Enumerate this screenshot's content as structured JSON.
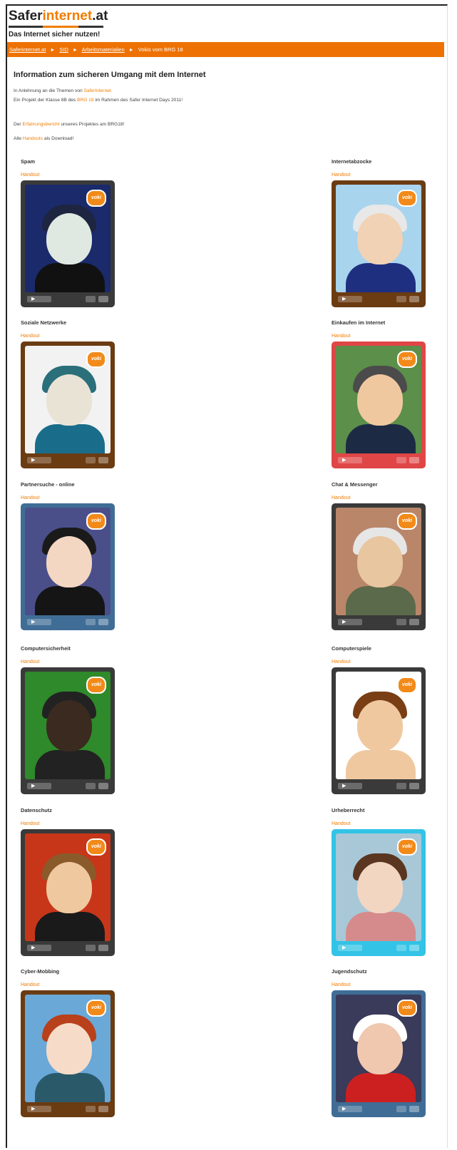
{
  "site": {
    "logo_safer": "Safer",
    "logo_internet": "internet",
    "logo_at": ".at",
    "tagline": "Das Internet sicher nutzen!"
  },
  "breadcrumb": {
    "items": [
      "Saferinternet.at",
      "SID",
      "Arbeitsmaterialien"
    ],
    "current": "Vokis vom BRG 18",
    "separator": "►"
  },
  "intro": {
    "heading": "Information zum sicheren Umgang mit dem Internet",
    "line1_prefix": "In Anlehnung an die Themen von ",
    "line1_link": "SaferInternet.",
    "line2_prefix": "Ein Projekt der Klasse 8B des ",
    "line2_link": "BRG 18",
    "line2_suffix": " im Rahmen des Safer Internet Days 2011!",
    "line3_prefix": "Der ",
    "line3_link": "Erfahrungsbericht",
    "line3_suffix": " unseres Projektes am BRG18!",
    "line4_prefix": "Alle ",
    "line4_link": "Handouts",
    "line4_suffix": " als Download!"
  },
  "handout_label": "Handout",
  "voki_badge": "voki",
  "play_glyph": "▶",
  "topics": [
    {
      "title": "Spam",
      "frame": "#3a3a3a",
      "bg": "#1a2a6a",
      "skin": "#dfe9e2",
      "hair": "#1e2540",
      "body": "#111111"
    },
    {
      "title": "Internetabzocke",
      "frame": "#6b3b12",
      "bg": "#a8d4ee",
      "skin": "#f1d2b5",
      "hair": "#e8e8e8",
      "body": "#1f2f80"
    },
    {
      "title": "Soziale Netzwerke",
      "frame": "#6b3b12",
      "bg": "#f2f2f2",
      "skin": "#e9e3d6",
      "hair": "#2a6f7a",
      "body": "#1a6d8a"
    },
    {
      "title": "Einkaufen im Internet",
      "frame": "#e04646",
      "bg": "#5c8f4a",
      "skin": "#f0c8a0",
      "hair": "#4b4b4b",
      "body": "#1c2a44"
    },
    {
      "title": "Partnersuche - online",
      "frame": "#3f6d96",
      "bg": "#4a4f8a",
      "skin": "#f4d7c2",
      "hair": "#1a1a1a",
      "body": "#151515"
    },
    {
      "title": "Chat & Messenger",
      "frame": "#3a3a3a",
      "bg": "#b9866a",
      "skin": "#e8c6a0",
      "hair": "#e6e6e6",
      "body": "#5a6a4a"
    },
    {
      "title": "Computersicherheit",
      "frame": "#3a3a3a",
      "bg": "#2e8a2a",
      "skin": "#3a2a20",
      "hair": "#222222",
      "body": "#222222"
    },
    {
      "title": "Computerspiele",
      "frame": "#3a3a3a",
      "bg": "#ffffff",
      "skin": "#f0c8a0",
      "hair": "#7a3e14",
      "body": "#f0c8a0"
    },
    {
      "title": "Datenschutz",
      "frame": "#3a3a3a",
      "bg": "#c8361a",
      "skin": "#f0c8a0",
      "hair": "#8a5a2a",
      "body": "#1a1a1a"
    },
    {
      "title": "Urheberrecht",
      "frame": "#33c3e6",
      "bg": "#a8c8d8",
      "skin": "#f2d6c2",
      "hair": "#5a3620",
      "body": "#d58b8b"
    },
    {
      "title": "Cyber-Mobbing",
      "frame": "#6b3b12",
      "bg": "#6aa8d8",
      "skin": "#f6dcc8",
      "hair": "#b8401a",
      "body": "#2a5a6a"
    },
    {
      "title": "Jugendschutz",
      "frame": "#3f6d96",
      "bg": "#3a3a5a",
      "skin": "#f0c8b0",
      "hair": "#ffffff",
      "body": "#cc2020"
    }
  ]
}
